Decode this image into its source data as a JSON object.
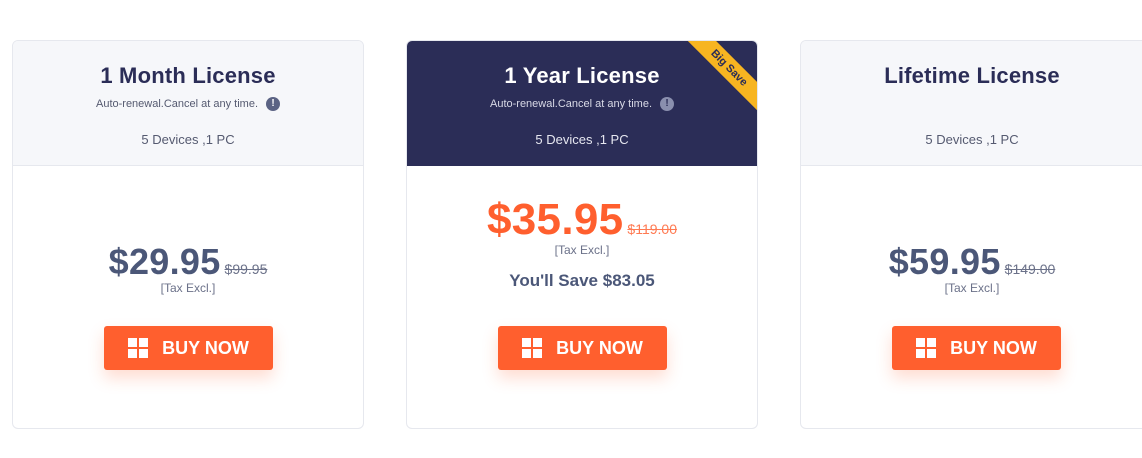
{
  "plans": [
    {
      "title": "1 Month License",
      "note": "Auto-renewal.Cancel at any time.",
      "devices": "5 Devices ,1 PC",
      "price": "$29.95",
      "old_price": "$99.95",
      "tax": "[Tax Excl.]",
      "buy_label": "BUY NOW"
    },
    {
      "title": "1 Year License",
      "note": "Auto-renewal.Cancel at any time.",
      "devices": "5 Devices ,1 PC",
      "ribbon": "Big Save",
      "price": "$35.95",
      "old_price": "$119.00",
      "tax": "[Tax Excl.]",
      "save": "You'll Save $83.05",
      "buy_label": "BUY NOW"
    },
    {
      "title": "Lifetime License",
      "devices": "5 Devices ,1 PC",
      "price": "$59.95",
      "old_price": "$149.00",
      "tax": "[Tax Excl.]",
      "buy_label": "BUY NOW"
    }
  ],
  "info_icon_glyph": "!",
  "colors": {
    "accent": "#ff5f2e",
    "featured_header": "#2b2d57",
    "ribbon": "#f7b521",
    "price_text": "#4b5778"
  }
}
